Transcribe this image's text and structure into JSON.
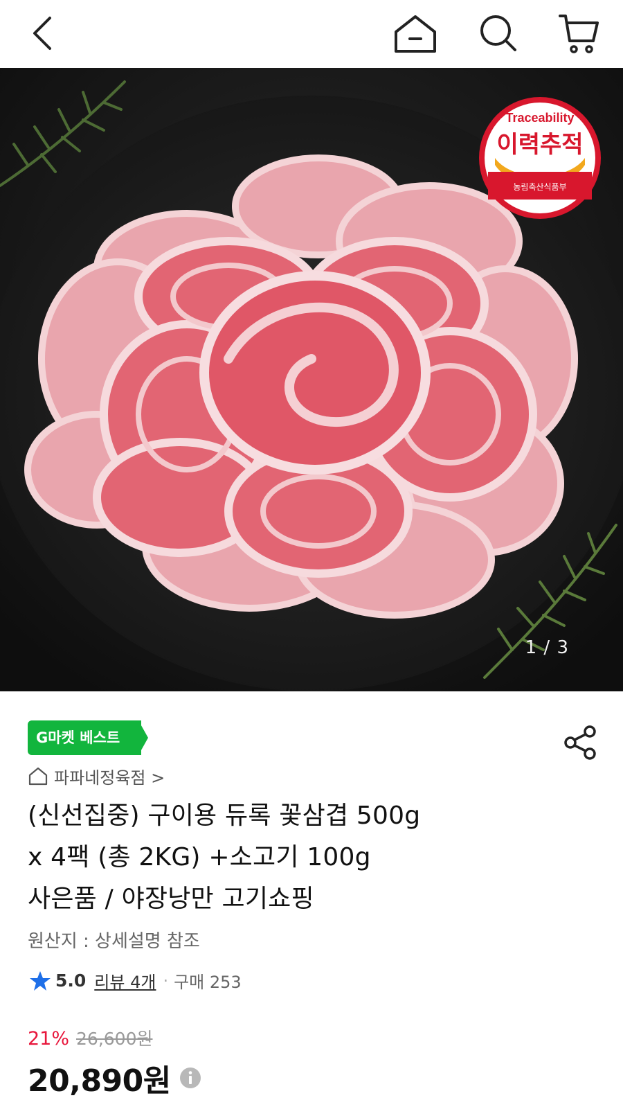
{
  "header": {
    "back_icon": "chevron-left-icon",
    "home_icon": "home-icon",
    "search_icon": "search-icon",
    "cart_icon": "cart-icon"
  },
  "hero": {
    "badge_en": "Traceability",
    "badge_ko": "이력추적",
    "badge_sub": "농림축산식품부",
    "counter": "1 / 3"
  },
  "product": {
    "best_badge": "G마켓 베스트",
    "store_name": "파파네정육점 >",
    "title_lines": [
      "(신선집중) 구이용 듀록 꽃삼겹 500g",
      "x 4팩 (총 2KG) +소고기 100g",
      "사은품 / 야장낭만 고기쇼핑"
    ],
    "origin": "원산지 : 상세설명 참조",
    "rating_score": "5.0",
    "review_label": "리뷰 4개",
    "separator": "·",
    "purchase_label": "구매 253",
    "discount_pct": "21%",
    "original_price": "26,600원",
    "sale_price": "20,890원"
  },
  "colors": {
    "brand_green": "#12b53d",
    "discount_red": "#e8173c",
    "star_blue": "#1e6fe8"
  }
}
